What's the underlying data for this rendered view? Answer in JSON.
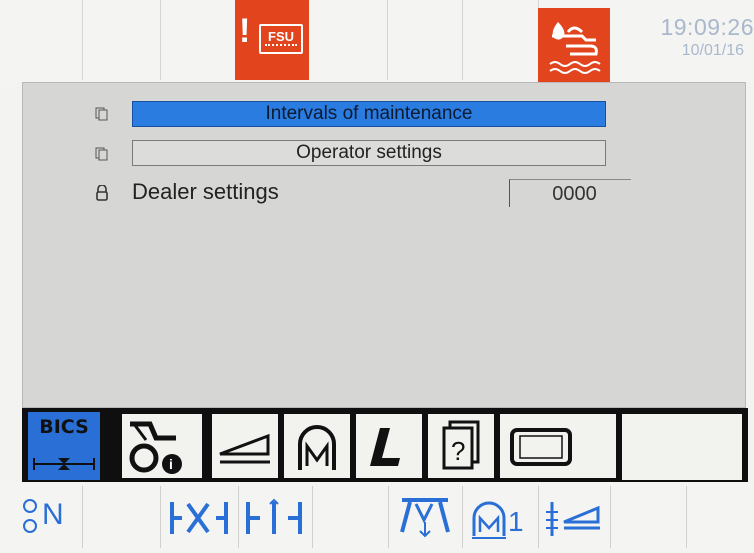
{
  "status": {
    "alarm_text": "FSU",
    "alarm_mark": "!",
    "time": "19:09:26",
    "date": "10/01/16"
  },
  "menu": {
    "items": [
      {
        "label": "Intervals of maintenance",
        "selected": true
      },
      {
        "label": "Operator settings",
        "selected": false
      }
    ],
    "dealer_label": "Dealer settings",
    "dealer_value": "0000"
  },
  "softkeys": {
    "bics_label": "BICS",
    "icons": [
      "bics-icon",
      "tractor-info-icon",
      "ramp-icon",
      "memory-m-icon",
      "l-icon",
      "help-book-icon",
      "display-icon"
    ]
  },
  "bottom": {
    "n_label": "N",
    "memory_count": "1",
    "icons": [
      "neutral-n-icon",
      "hitch-wide-icon",
      "hitch-narrow-icon",
      "lift-arms-icon",
      "memory-one-icon",
      "depth-control-icon"
    ]
  },
  "colors": {
    "accent_blue": "#2a6fd6",
    "alarm_red": "#e2441e",
    "clock_text": "#a9b8cc"
  }
}
